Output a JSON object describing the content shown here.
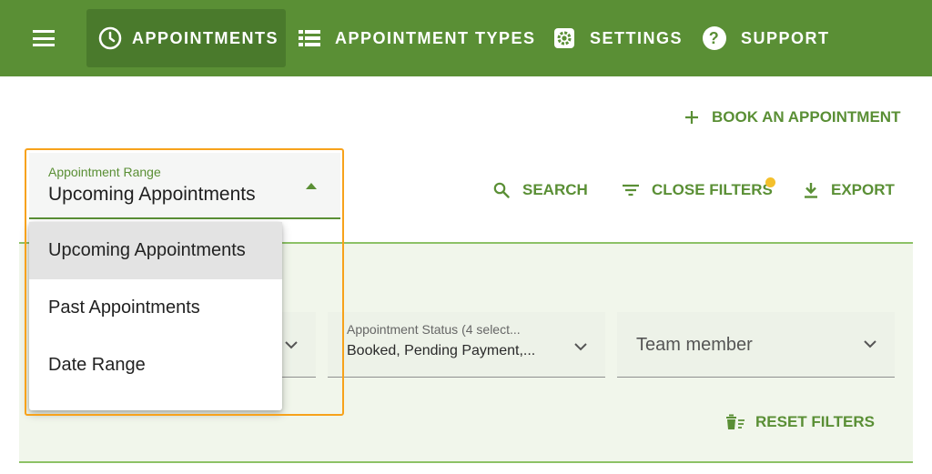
{
  "nav": {
    "items": [
      {
        "label": "APPOINTMENTS",
        "icon": "clock-icon",
        "active": true
      },
      {
        "label": "APPOINTMENT TYPES",
        "icon": "list-icon",
        "active": false
      },
      {
        "label": "SETTINGS",
        "icon": "gear-icon",
        "active": false
      },
      {
        "label": "SUPPORT",
        "icon": "help-icon",
        "active": false
      }
    ]
  },
  "toolbar": {
    "book_label": "BOOK AN APPOINTMENT",
    "search_label": "SEARCH",
    "close_filters_label": "CLOSE FILTERS",
    "export_label": "EXPORT"
  },
  "range": {
    "label": "Appointment Range",
    "value": "Upcoming Appointments",
    "options": [
      "Upcoming Appointments",
      "Past Appointments",
      "Date Range"
    ]
  },
  "filters": {
    "status": {
      "label": "Appointment Status (4 select...",
      "value": "Booked, Pending Payment,..."
    },
    "team": {
      "placeholder": "Team member"
    },
    "reset_label": "RESET FILTERS"
  },
  "colors": {
    "primary": "#5a8f35",
    "highlight": "#f7a21b",
    "badge": "#f4c02c"
  }
}
